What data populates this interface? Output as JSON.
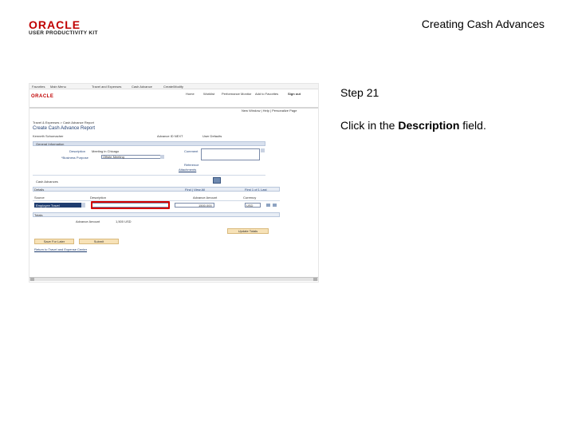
{
  "slide": {
    "title": "Creating Cash Advances",
    "step": "Step 21",
    "instruction_prefix": "Click in the ",
    "instruction_bold": "Description",
    "instruction_suffix": " field."
  },
  "logo": {
    "brand": "ORACLE",
    "tagline": "USER PRODUCTIVITY KIT"
  },
  "screenshot": {
    "top_links": [
      "Favorites",
      "Main Menu",
      "Travel and Expenses",
      "Cash Advance",
      "Create/Modify"
    ],
    "brand": "ORACLE",
    "nav_items": [
      "Home",
      "Worklist",
      "Performance Monitor",
      "Add to Favorites",
      "Sign out"
    ],
    "sub_links": "New Window | Help | Personalize Page",
    "breadcrumb": "Travel & Expenses > Cash Advance Report",
    "page_title": "Create Cash Advance Report",
    "employee": "Kenneth Schumacher",
    "advance_id": "Advance ID NEXT",
    "user_defaults": "User Defaults",
    "general_info_label": "General Information",
    "description_label": "Description",
    "description_value": "Meeting in Chicago",
    "business_purpose_label": "*Business Purpose",
    "business_purpose_value": "Offsite Meeting",
    "comment_label": "Comment",
    "reference_label": "Reference",
    "attachments_link": "Attachments",
    "cash_advances_label": "Cash Advances",
    "details_label": "Details",
    "find_label": "Find | View All",
    "pager": "First 1 of 1 Last",
    "col_source": "Source",
    "col_description": "Description",
    "col_amount": "Advance Amount",
    "col_currency": "Currency",
    "row_source": "Employee Travel",
    "row_amount": "1500.000",
    "row_currency": "USD",
    "totals_label": "Totals",
    "advance_amount_label": "Advance Amount",
    "advance_amount_value": "1,500 USD",
    "update_totals_button": "Update Totals",
    "save_later_button": "Save For Later",
    "submit_button": "Submit",
    "return_link": "Return to Travel and Expense Center"
  },
  "colors": {
    "highlight": "#d40000",
    "brand_red": "#c00000"
  }
}
